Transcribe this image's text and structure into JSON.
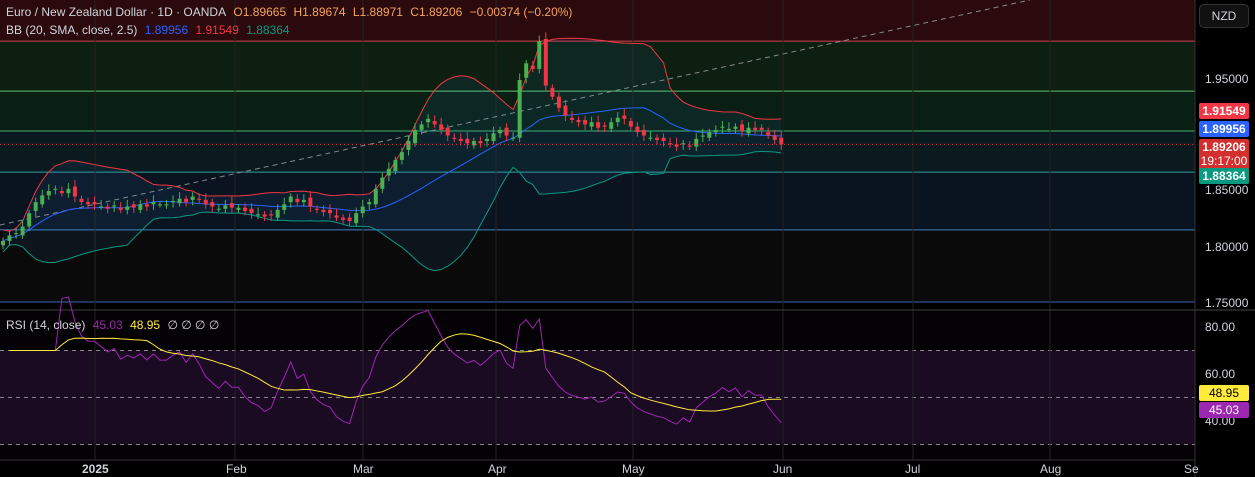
{
  "header": {
    "symbol": "Euro / New Zealand Dollar · 1D · OANDA",
    "open": "O1.89665",
    "high": "H1.89674",
    "low": "L1.88971",
    "close": "C1.89206",
    "change": "−0.00374 (−0.20%)"
  },
  "bb": {
    "label": "BB (20, SMA, close, 2.5)",
    "basis": "1.89956",
    "upper": "1.91549",
    "lower": "1.88364"
  },
  "rsi": {
    "label": "RSI (14, close)",
    "value": "45.03",
    "ma": "48.95",
    "extras": "∅ ∅ ∅ ∅"
  },
  "currency": "NZD",
  "price_tags": {
    "upper": "1.91549",
    "basis": "1.89956",
    "last": "1.89206",
    "countdown": "19:17:00",
    "lower": "1.88364",
    "rsi_ma": "48.95",
    "rsi": "45.03"
  },
  "colors": {
    "up": "#26a69a",
    "upbright": "#4caf50",
    "down": "#f23645",
    "basis": "#2962ff",
    "upper": "#f23645",
    "lower": "#089981",
    "rsi": "#9c27b0",
    "rsima": "#ffeb3b"
  },
  "chart_data": {
    "type": "candlestick",
    "title": "Euro / New Zealand Dollar · 1D · OANDA",
    "price_axis_ticks": [
      "1.95000",
      "1.80000",
      "1.75000",
      "1.85000"
    ],
    "rsi_axis_ticks": [
      "80.00",
      "60.00",
      "40.00"
    ],
    "time_labels": [
      "2025",
      "Feb",
      "Mar",
      "Apr",
      "May",
      "Jun",
      "Jul",
      "Aug",
      "Se"
    ],
    "ylim": [
      1.745,
      2.02
    ],
    "closes": [
      1.805,
      1.81,
      1.812,
      1.818,
      1.83,
      1.84,
      1.846,
      1.85,
      1.852,
      1.848,
      1.852,
      1.845,
      1.84,
      1.838,
      1.838,
      1.836,
      1.834,
      1.837,
      1.833,
      1.836,
      1.835,
      1.838,
      1.836,
      1.84,
      1.838,
      1.838,
      1.841,
      1.843,
      1.84,
      1.845,
      1.842,
      1.838,
      1.836,
      1.834,
      1.837,
      1.835,
      1.835,
      1.832,
      1.83,
      1.829,
      1.827,
      1.828,
      1.833,
      1.838,
      1.845,
      1.84,
      1.842,
      1.836,
      1.833,
      1.831,
      1.83,
      1.826,
      1.824,
      1.823,
      1.83,
      1.836,
      1.84,
      1.852,
      1.862,
      1.87,
      1.878,
      1.885,
      1.895,
      1.905,
      1.91,
      1.915,
      1.91,
      1.905,
      1.9,
      1.897,
      1.895,
      1.893,
      1.895,
      1.893,
      1.897,
      1.902,
      1.905,
      1.9,
      1.898,
      1.95,
      1.965,
      1.96,
      1.985,
      1.945,
      1.935,
      1.925,
      1.918,
      1.914,
      1.912,
      1.91,
      1.912,
      1.907,
      1.908,
      1.912,
      1.916,
      1.915,
      1.908,
      1.903,
      1.9,
      1.898,
      1.896,
      1.895,
      1.892,
      1.89,
      1.893,
      1.89,
      1.897,
      1.9,
      1.903,
      1.905,
      1.908,
      1.906,
      1.908,
      1.904,
      1.907,
      1.905,
      1.905,
      1.9,
      1.896,
      1.892
    ],
    "zones": [
      1.985,
      1.94,
      1.904,
      1.867,
      1.815,
      1.75
    ]
  }
}
